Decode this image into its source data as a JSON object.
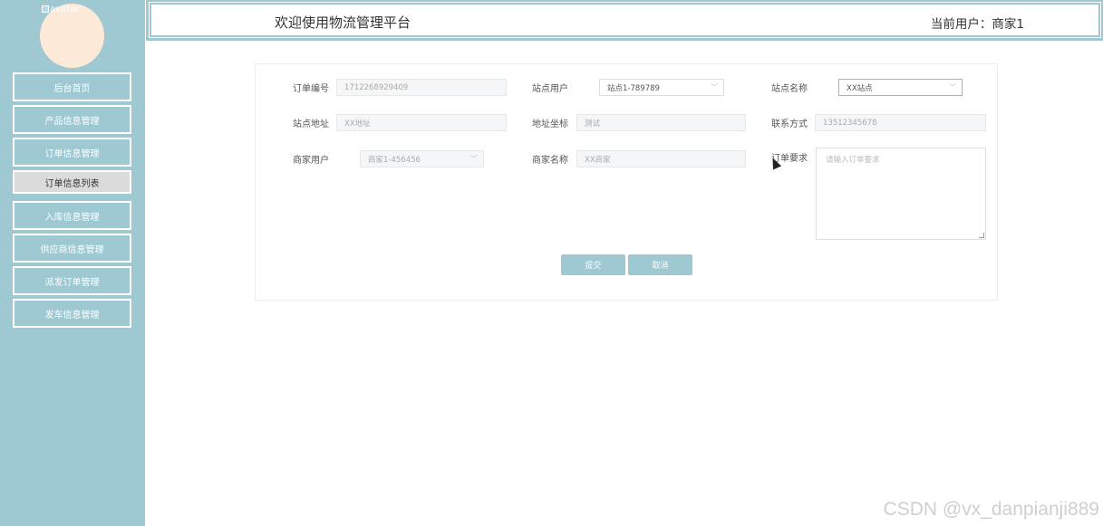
{
  "sidebar": {
    "avatar_alt": "avatar",
    "items": [
      {
        "label": "后台首页"
      },
      {
        "label": "产品信息管理"
      },
      {
        "label": "订单信息管理"
      },
      {
        "label": "订单信息列表"
      },
      {
        "label": "入库信息管理"
      },
      {
        "label": "供应商信息管理"
      },
      {
        "label": "派发订单管理"
      },
      {
        "label": "发车信息管理"
      }
    ],
    "active_index": 3
  },
  "header": {
    "title": "欢迎使用物流管理平台",
    "user": "当前用户：商家1"
  },
  "form": {
    "order_no": {
      "label": "订单编号",
      "value": "1712268929409"
    },
    "station_user": {
      "label": "站点用户",
      "value": "站点1-789789"
    },
    "station_name": {
      "label": "站点名称",
      "value": "XX站点"
    },
    "station_address": {
      "label": "站点地址",
      "value": "XX地址"
    },
    "coords": {
      "label": "地址坐标",
      "value": "测试"
    },
    "contact": {
      "label": "联系方式",
      "value": "13512345678"
    },
    "merchant_user": {
      "label": "商家用户",
      "value": "商家1-456456"
    },
    "merchant_name": {
      "label": "商家名称",
      "value": "XX商家"
    },
    "requirements": {
      "label": "订单要求",
      "placeholder": "请输入订单要求"
    },
    "submit_label": "提交",
    "cancel_label": "取消"
  },
  "watermark": "CSDN @vx_danpianji889",
  "colors": {
    "accent": "#9ec9d3",
    "avatar": "#fde9d7"
  }
}
